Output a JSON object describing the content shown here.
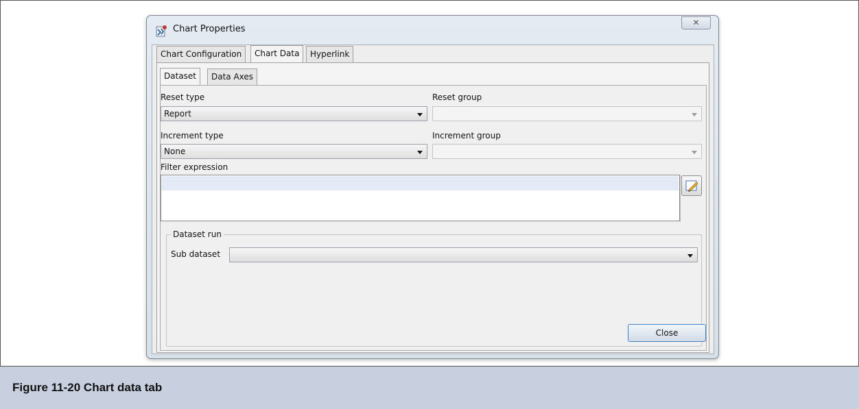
{
  "dialog": {
    "title": "Chart Properties",
    "app_icon": "jasper-report-icon",
    "close_glyph": "✕",
    "close_button": "Close"
  },
  "tabs": [
    "Chart Configuration",
    "Chart Data",
    "Hyperlink"
  ],
  "subtabs": [
    "Dataset",
    "Data Axes"
  ],
  "form": {
    "reset_type_label": "Reset type",
    "reset_type_value": "Report",
    "reset_group_label": "Reset group",
    "increment_type_label": "Increment type",
    "increment_type_value": "None",
    "increment_group_label": "Increment group",
    "filter_expression_label": "Filter expression",
    "dataset_run_label": "Dataset run",
    "sub_dataset_label": "Sub dataset",
    "expression_editor_icon": "edit-expression-icon"
  },
  "caption": "Figure 11-20  Chart data tab"
}
